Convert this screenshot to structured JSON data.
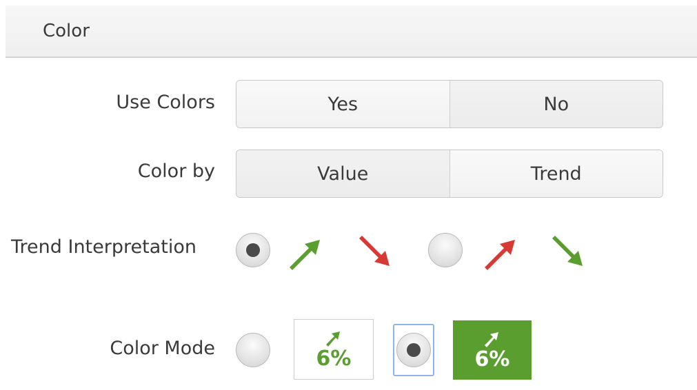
{
  "section": {
    "title": "Color"
  },
  "use_colors": {
    "label": "Use Colors",
    "options": [
      "Yes",
      "No"
    ],
    "selected": "Yes"
  },
  "color_by": {
    "label": "Color by",
    "options": [
      "Value",
      "Trend"
    ],
    "selected": "Trend"
  },
  "trend_interpretation": {
    "label": "Trend Interpretation",
    "options": [
      {
        "up_color": "#5a9e2f",
        "down_color": "#d73a35",
        "selected": true
      },
      {
        "up_color": "#d73a35",
        "down_color": "#5a9e2f",
        "selected": false
      }
    ]
  },
  "color_mode": {
    "label": "Color Mode",
    "options": [
      {
        "style": "text-colored",
        "sample_value": "6%",
        "selected": false
      },
      {
        "style": "background-colored",
        "sample_value": "6%",
        "selected": true
      }
    ]
  },
  "colors": {
    "green": "#5a9e2f",
    "red": "#d73a35"
  },
  "icons": {
    "up": "arrow-up-right-icon",
    "down": "arrow-down-right-icon"
  }
}
